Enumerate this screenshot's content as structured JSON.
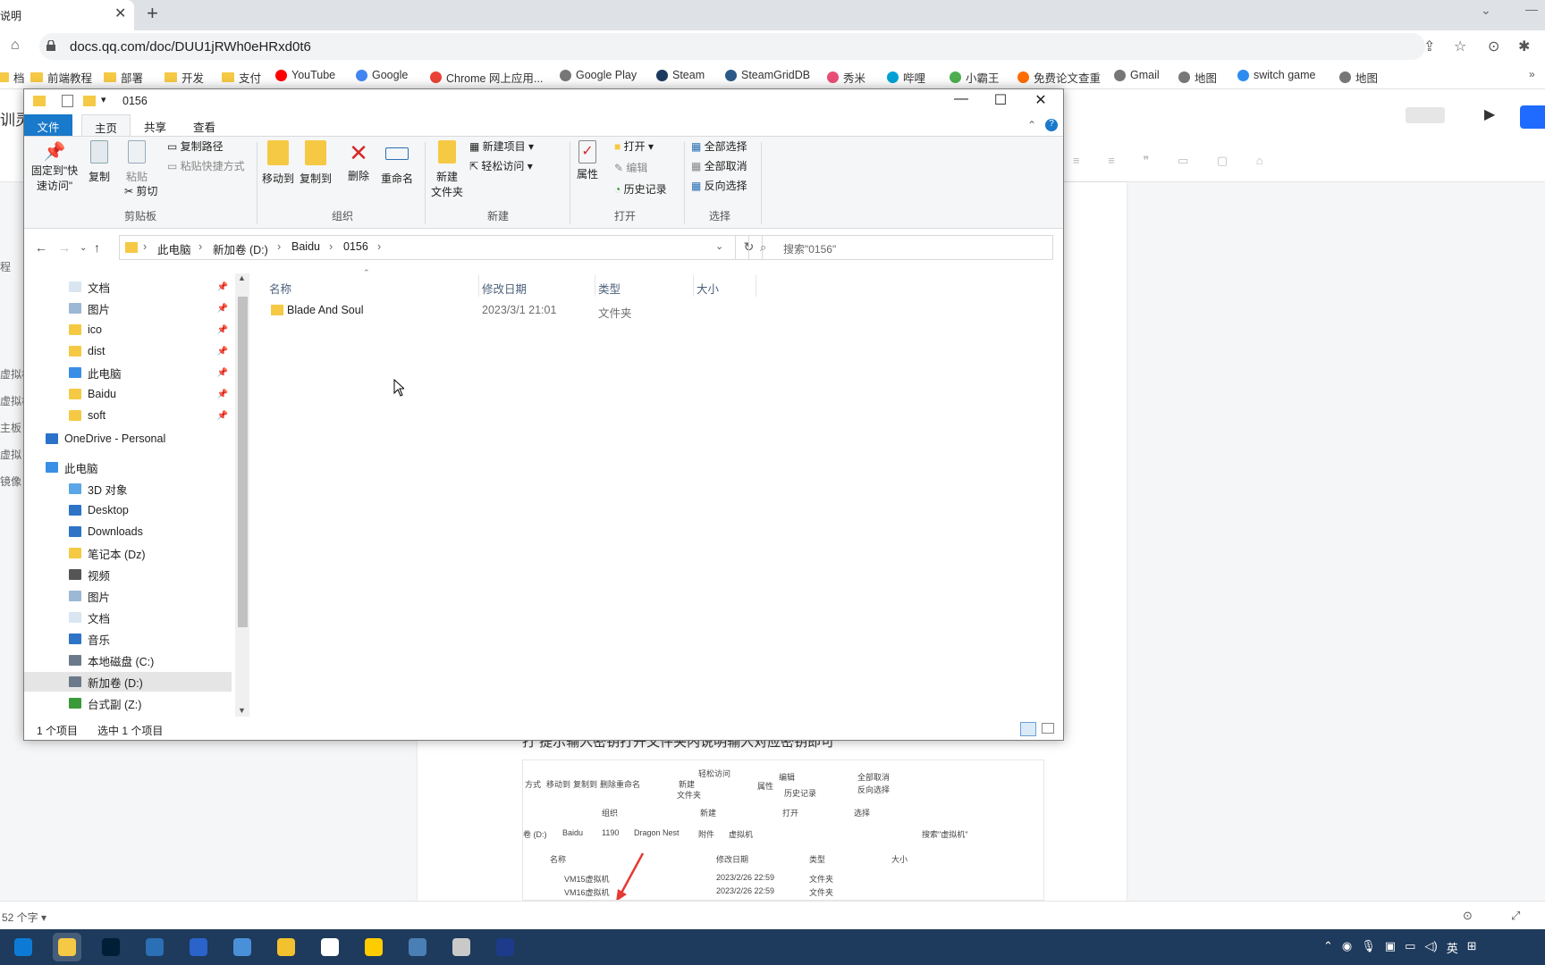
{
  "browser": {
    "tab_title": "说明",
    "url": "docs.qq.com/doc/DUU1jRWh0eHRxd0t6",
    "bookmarks": [
      {
        "label": "档",
        "icon": "folder-icon"
      },
      {
        "label": "前端教程",
        "icon": "folder-icon"
      },
      {
        "label": "部署",
        "icon": "folder-icon"
      },
      {
        "label": "开发",
        "icon": "folder-icon"
      },
      {
        "label": "支付",
        "icon": "folder-icon"
      },
      {
        "label": "YouTube",
        "icon": "youtube-icon"
      },
      {
        "label": "Google",
        "icon": "google-icon"
      },
      {
        "label": "Chrome 网上应用...",
        "icon": "chrome-store-icon"
      },
      {
        "label": "Google Play",
        "icon": "globe-icon"
      },
      {
        "label": "Steam",
        "icon": "steam-icon"
      },
      {
        "label": "SteamGridDB",
        "icon": "steamgriddb-icon"
      },
      {
        "label": "秀米",
        "icon": "xiumi-icon"
      },
      {
        "label": "哔哩",
        "icon": "bilibili-icon"
      },
      {
        "label": "小霸王",
        "icon": "game-icon"
      },
      {
        "label": "免费论文查重",
        "icon": "paper-icon"
      },
      {
        "label": "Gmail",
        "icon": "globe-icon"
      },
      {
        "label": "地图",
        "icon": "globe-icon"
      },
      {
        "label": "switch game",
        "icon": "switch-icon"
      },
      {
        "label": "地图",
        "icon": "globe-icon"
      }
    ]
  },
  "doc": {
    "left_title": "训灵",
    "side_items": [
      "程",
      "虚拟机",
      "虚拟机",
      "主板",
      "虚拟",
      "镜像"
    ],
    "body_line": "打 提示输入密钥打开文件夹内说明输入对应密钥即可",
    "word_count": "52 个字",
    "embedded": {
      "ribbon": [
        "方式",
        "移动到",
        "复制到",
        "删除",
        "重命名",
        "新建",
        "文件夹",
        "轻松访问",
        "属性",
        "编辑",
        "历史记录",
        "全部取消",
        "反向选择",
        "组织",
        "新建",
        "打开",
        "选择"
      ],
      "path": [
        "卷 (D:)",
        "Baidu",
        "1190",
        "Dragon Nest",
        "附件",
        "虚拟机"
      ],
      "search": "搜索\"虚拟机\"",
      "headers": [
        "名称",
        "修改日期",
        "类型",
        "大小"
      ],
      "rows": [
        {
          "name": "VM15虚拟机",
          "date": "2023/2/26 22:59",
          "type": "文件夹"
        },
        {
          "name": "VM16虚拟机",
          "date": "2023/2/26 22:59",
          "type": "文件夹"
        }
      ]
    }
  },
  "explorer": {
    "title": "0156",
    "tabs": {
      "file": "文件",
      "home": "主页",
      "share": "共享",
      "view": "查看"
    },
    "ribbon": {
      "pin_quick_1": "固定到\"快",
      "pin_quick_2": "速访问\"",
      "copy": "复制",
      "paste": "粘贴",
      "copy_path": "复制路径",
      "paste_shortcut": "粘贴快捷方式",
      "cut": "剪切",
      "group_clipboard": "剪贴板",
      "move_to": "移动到",
      "copy_to": "复制到",
      "delete": "删除",
      "rename": "重命名",
      "group_organize": "组织",
      "new_folder_1": "新建",
      "new_folder_2": "文件夹",
      "new_item": "新建项目",
      "easy_access": "轻松访问",
      "group_new": "新建",
      "properties": "属性",
      "open": "打开",
      "edit": "编辑",
      "history": "历史记录",
      "group_open": "打开",
      "select_all": "全部选择",
      "select_none": "全部取消",
      "invert_selection": "反向选择",
      "group_select": "选择"
    },
    "breadcrumb": [
      "此电脑",
      "新加卷 (D:)",
      "Baidu",
      "0156"
    ],
    "search_placeholder": "搜索\"0156\"",
    "nav": [
      {
        "label": "文档",
        "pinned": true
      },
      {
        "label": "图片",
        "pinned": true
      },
      {
        "label": "ico",
        "pinned": true
      },
      {
        "label": "dist",
        "pinned": true
      },
      {
        "label": "此电脑",
        "pinned": true
      },
      {
        "label": "Baidu",
        "pinned": true
      },
      {
        "label": "soft",
        "pinned": true
      },
      {
        "label": "OneDrive - Personal"
      },
      {
        "label": "此电脑"
      },
      {
        "label": "3D 对象"
      },
      {
        "label": "Desktop"
      },
      {
        "label": "Downloads"
      },
      {
        "label": "笔记本 (Dz)"
      },
      {
        "label": "视频"
      },
      {
        "label": "图片"
      },
      {
        "label": "文档"
      },
      {
        "label": "音乐"
      },
      {
        "label": "本地磁盘 (C:)"
      },
      {
        "label": "新加卷 (D:)",
        "selected": true
      },
      {
        "label": "台式副 (Z:)"
      }
    ],
    "columns": {
      "name": "名称",
      "date": "修改日期",
      "type": "类型",
      "size": "大小"
    },
    "files": [
      {
        "name": "Blade And Soul",
        "date": "2023/3/1 21:01",
        "type": "文件夹",
        "size": ""
      }
    ],
    "status": {
      "count": "1 个项目",
      "selected": "选中 1 个项目"
    }
  },
  "taskbar": {
    "apps": [
      "edge-icon",
      "file-explorer-icon",
      "photoshop-icon",
      "app-icon",
      "app-icon",
      "cloud-icon",
      "star-icon",
      "chrome-icon",
      "player-icon",
      "app-icon",
      "app-icon",
      "app-icon"
    ],
    "ime": "英"
  },
  "colors": {
    "ribbon_file_tab": "#1979ca",
    "folder": "#f6c945",
    "share_button": "#1f6bff",
    "taskbar": "#1e3a5c"
  }
}
